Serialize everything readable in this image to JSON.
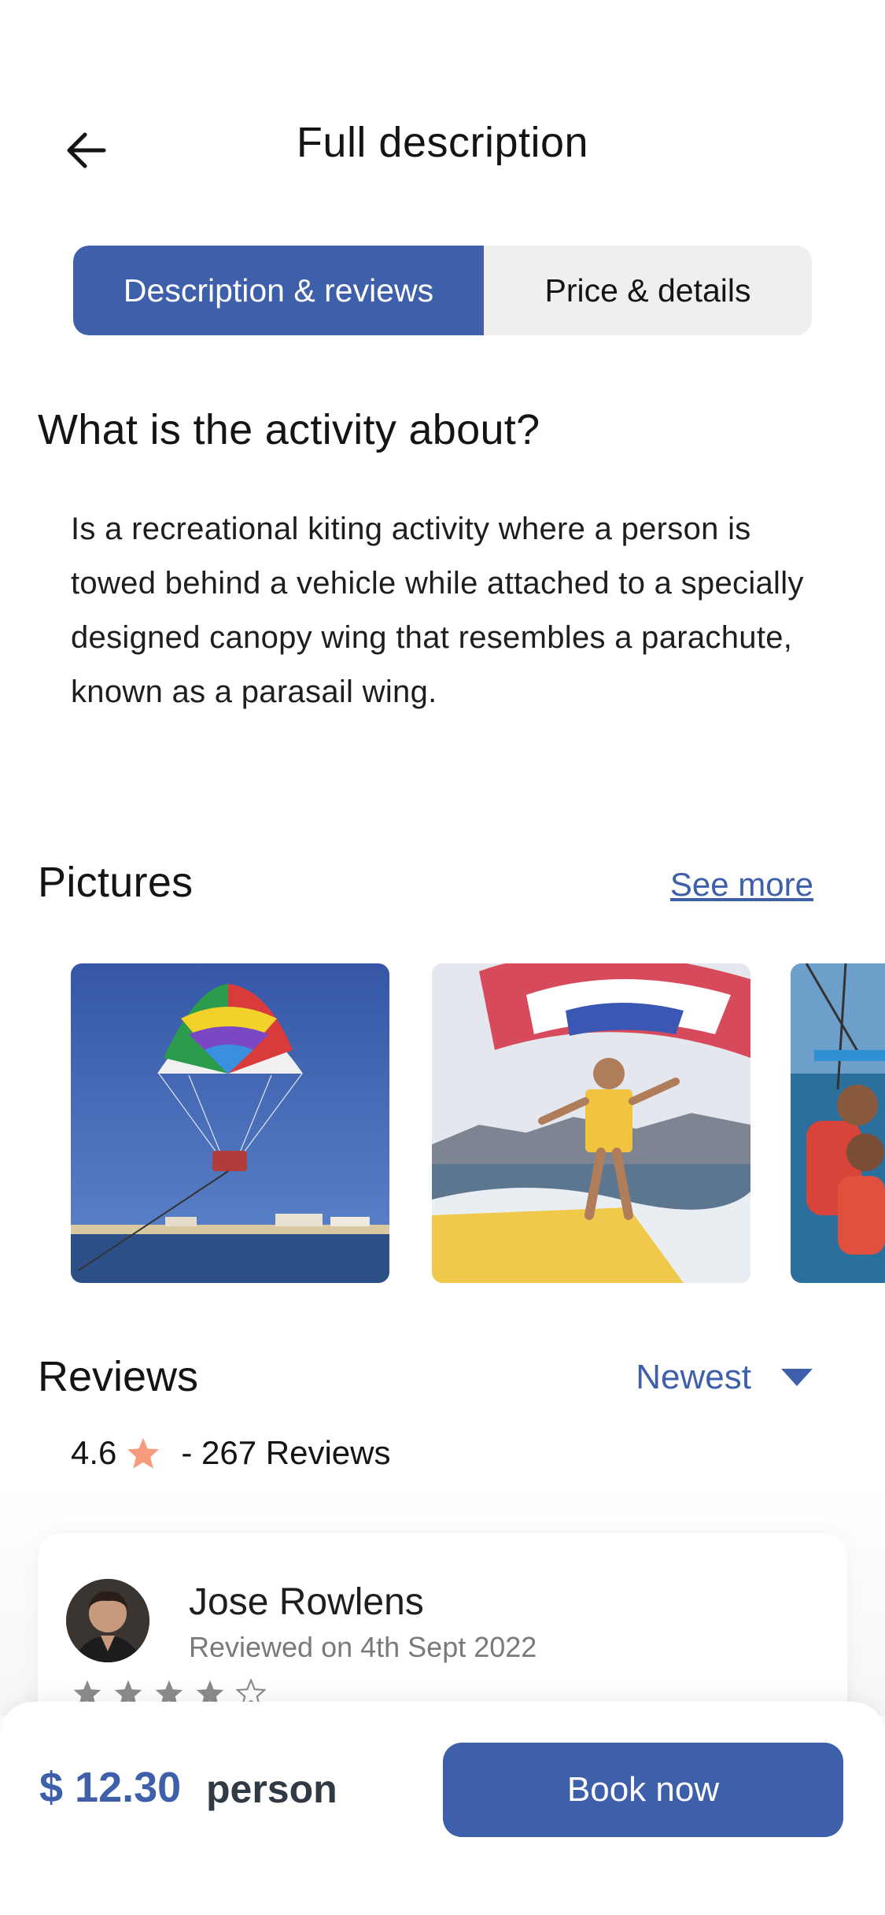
{
  "header": {
    "title": "Full description",
    "back_icon": "arrow-left-icon"
  },
  "tabs": [
    {
      "label": "Description & reviews",
      "active": true
    },
    {
      "label": "Price & details",
      "active": false
    }
  ],
  "about": {
    "title": "What is the activity about?",
    "text": "Is a recreational kiting activity where a person is towed behind a vehicle while attached to a specially designed canopy wing that resembles a parachute, known as a parasail wing."
  },
  "pictures": {
    "title": "Pictures",
    "see_more": "See more"
  },
  "reviews": {
    "title": "Reviews",
    "sort_label": "Newest",
    "rating": "4.6",
    "count_text": "- 267 Reviews",
    "items": [
      {
        "name": "Jose Rowlens",
        "date": "Reviewed on 4th Sept 2022",
        "stars": 4
      }
    ]
  },
  "booking": {
    "price": "$ 12.30",
    "unit": "person",
    "button": "Book now"
  },
  "colors": {
    "accent": "#3e5fa9",
    "star": "#f79b7d",
    "tab_bg": "#efefef"
  }
}
